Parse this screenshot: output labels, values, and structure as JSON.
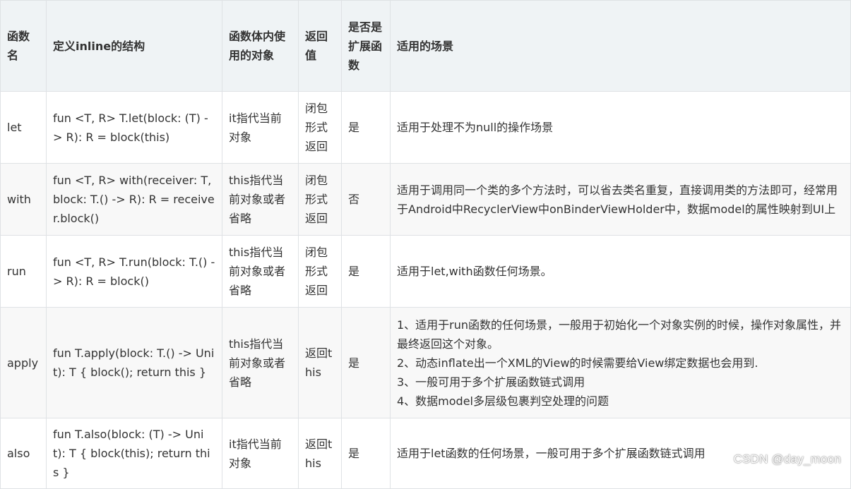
{
  "table": {
    "headers": {
      "name": "函数名",
      "signature": "定义inline的结构",
      "receiver_object": "函数体内使用的对象",
      "return_value": "返回值",
      "is_extension": "是否是扩展函数",
      "scenario": "适用的场景"
    },
    "rows": [
      {
        "name": "let",
        "signature": "fun <T, R> T.let(block: (T) -> R): R = block(this)",
        "receiver_object": "it指代当前对象",
        "return_value": "闭包形式返回",
        "is_extension": "是",
        "scenario": [
          "适用于处理不为null的操作场景"
        ]
      },
      {
        "name": "with",
        "signature": "fun <T, R> with(receiver: T, block: T.() -> R): R = receiver.block()",
        "receiver_object": "this指代当前对象或者省略",
        "return_value": "闭包形式返回",
        "is_extension": "否",
        "scenario": [
          "适用于调用同一个类的多个方法时，可以省去类名重复，直接调用类的方法即可，经常用于Android中RecyclerView中onBinderViewHolder中，数据model的属性映射到UI上"
        ]
      },
      {
        "name": "run",
        "signature": "fun <T, R> T.run(block: T.() -> R): R = block()",
        "receiver_object": "this指代当前对象或者省略",
        "return_value": "闭包形式返回",
        "is_extension": "是",
        "scenario": [
          "适用于let,with函数任何场景。"
        ]
      },
      {
        "name": "apply",
        "signature": "fun T.apply(block: T.() -> Unit): T { block(); return this }",
        "receiver_object": "this指代当前对象或者省略",
        "return_value": "返回this",
        "is_extension": "是",
        "scenario": [
          "1、适用于run函数的任何场景，一般用于初始化一个对象实例的时候，操作对象属性，并最终返回这个对象。",
          "2、动态inflate出一个XML的View的时候需要给View绑定数据也会用到.",
          "3、一般可用于多个扩展函数链式调用",
          "4、数据model多层级包裹判空处理的问题"
        ]
      },
      {
        "name": "also",
        "signature": "fun T.also(block: (T) -> Unit): T { block(this); return this }",
        "receiver_object": "it指代当前对象",
        "return_value": "返回this",
        "is_extension": "是",
        "scenario": [
          "适用于let函数的任何场景，一般可用于多个扩展函数链式调用"
        ]
      }
    ]
  },
  "watermark": "CSDN @day_moon"
}
